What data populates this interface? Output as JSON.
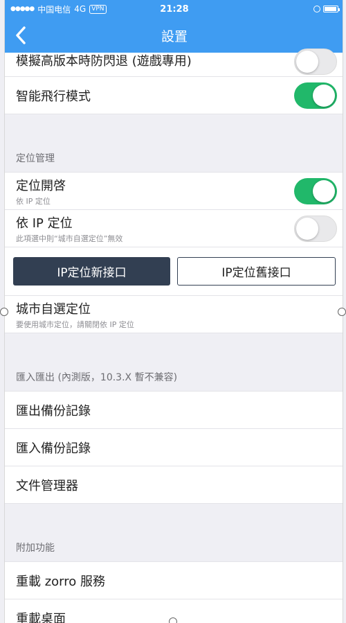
{
  "status_bar": {
    "carrier": "中国电信",
    "network": "4G",
    "vpn": "VPN",
    "time": "21:28"
  },
  "nav": {
    "title": "設置",
    "back_icon": "chevron-left-icon"
  },
  "rows_top": [
    {
      "label": "模擬高版本時防閃退 (遊戲專用)",
      "toggle": false
    },
    {
      "label": "智能飛行模式",
      "toggle": true
    }
  ],
  "location": {
    "header": "定位管理",
    "enable": {
      "label": "定位開啓",
      "sub": "依 IP 定位",
      "toggle": true
    },
    "ip": {
      "label": "依 IP 定位",
      "sub": "此項選中則“城市自選定位”無效",
      "toggle": false
    },
    "buttons": {
      "new": "IP定位新接口",
      "old": "IP定位舊接口"
    },
    "city": {
      "label": "城市自選定位",
      "sub": "要使用城市定位，請關閉依 IP 定位"
    }
  },
  "import_export": {
    "header": "匯入匯出 (內測版，10.3.X 暫不兼容)",
    "items": [
      "匯出備份記錄",
      "匯入備份記錄",
      "文件管理器"
    ]
  },
  "extras": {
    "header": "附加功能",
    "items": [
      "重載 zorro 服務",
      "重載桌面"
    ]
  },
  "colors": {
    "nav_bg": "#3f9cf2",
    "toggle_on": "#21b86a",
    "button_dark": "#323f52"
  }
}
